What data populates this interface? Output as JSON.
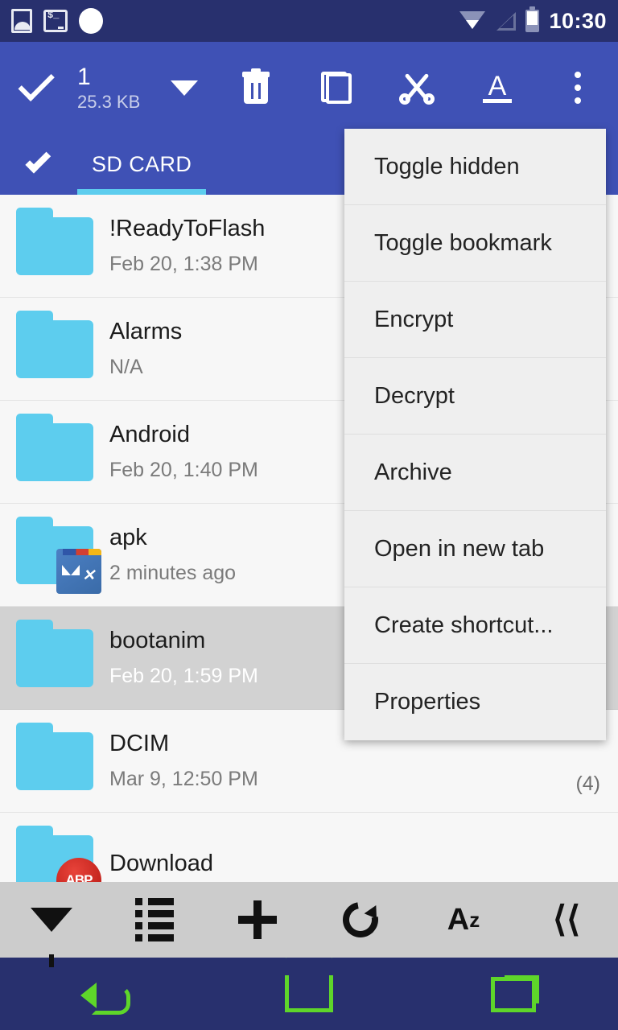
{
  "statusbar": {
    "clock": "10:30",
    "notification_icons": [
      "image-icon",
      "terminal-icon",
      "circle-icon"
    ],
    "system_icons": [
      "wifi-icon",
      "cell-signal-icon",
      "battery-icon"
    ],
    "background_color": "#28306e"
  },
  "toolbar": {
    "background_color": "#3f51b5",
    "selection_count": "1",
    "selection_size": "25.3 KB",
    "actions": [
      {
        "name": "delete-button",
        "icon": "trash-icon"
      },
      {
        "name": "copy-button",
        "icon": "copy-icon"
      },
      {
        "name": "cut-button",
        "icon": "scissors-icon"
      },
      {
        "name": "rename-button",
        "icon": "font-a-icon",
        "label": "A"
      },
      {
        "name": "overflow-button",
        "icon": "more-vertical-icon"
      }
    ]
  },
  "tabs": {
    "active": "SD CARD",
    "items": [
      {
        "label": "SD CARD"
      }
    ],
    "underline_color": "#5dcdee"
  },
  "files": {
    "folder_color": "#5dcdee",
    "rows": [
      {
        "name": "!ReadyToFlash",
        "date": "Feb 20, 1:38 PM",
        "selected": false,
        "badge": "",
        "count": ""
      },
      {
        "name": "Alarms",
        "date": "N/A",
        "selected": false,
        "badge": "",
        "count": ""
      },
      {
        "name": "Android",
        "date": "Feb 20, 1:40 PM",
        "selected": false,
        "badge": "",
        "count": ""
      },
      {
        "name": "apk",
        "date": "2 minutes ago",
        "selected": false,
        "badge": "apk-thumbnail-icon",
        "count": ""
      },
      {
        "name": "bootanim",
        "date": "Feb 20, 1:59 PM",
        "selected": true,
        "badge": "",
        "count": ""
      },
      {
        "name": "DCIM",
        "date": "Mar 9, 12:50 PM",
        "selected": false,
        "badge": "",
        "count": "(4)"
      },
      {
        "name": "Download",
        "date": "",
        "selected": false,
        "badge": "adblock-thumbnail-icon",
        "badge_text": "ABP",
        "count": ""
      }
    ]
  },
  "context_menu": {
    "background_color": "#efefef",
    "items": [
      {
        "label": "Toggle hidden"
      },
      {
        "label": "Toggle bookmark"
      },
      {
        "label": "Encrypt"
      },
      {
        "label": "Decrypt"
      },
      {
        "label": "Archive"
      },
      {
        "label": "Open in new tab"
      },
      {
        "label": "Create shortcut..."
      },
      {
        "label": "Properties"
      }
    ]
  },
  "bottom_toolbar": {
    "background_color": "#cccccc",
    "buttons": [
      {
        "name": "filter-button",
        "icon": "filter-icon"
      },
      {
        "name": "list-view-button",
        "icon": "list-icon"
      },
      {
        "name": "add-button",
        "icon": "plus-icon"
      },
      {
        "name": "refresh-button",
        "icon": "refresh-icon"
      },
      {
        "name": "sort-button",
        "icon": "sort-az-icon",
        "label_primary": "A",
        "label_secondary": "z"
      },
      {
        "name": "network-button",
        "icon": "wifi-signal-icon"
      }
    ]
  },
  "navbar": {
    "background_color": "#28306e",
    "icon_color": "#5ed62a",
    "buttons": [
      {
        "name": "nav-back-button",
        "icon": "back-arrow-icon"
      },
      {
        "name": "nav-home-button",
        "icon": "home-icon"
      },
      {
        "name": "nav-recents-button",
        "icon": "recents-icon"
      }
    ]
  }
}
